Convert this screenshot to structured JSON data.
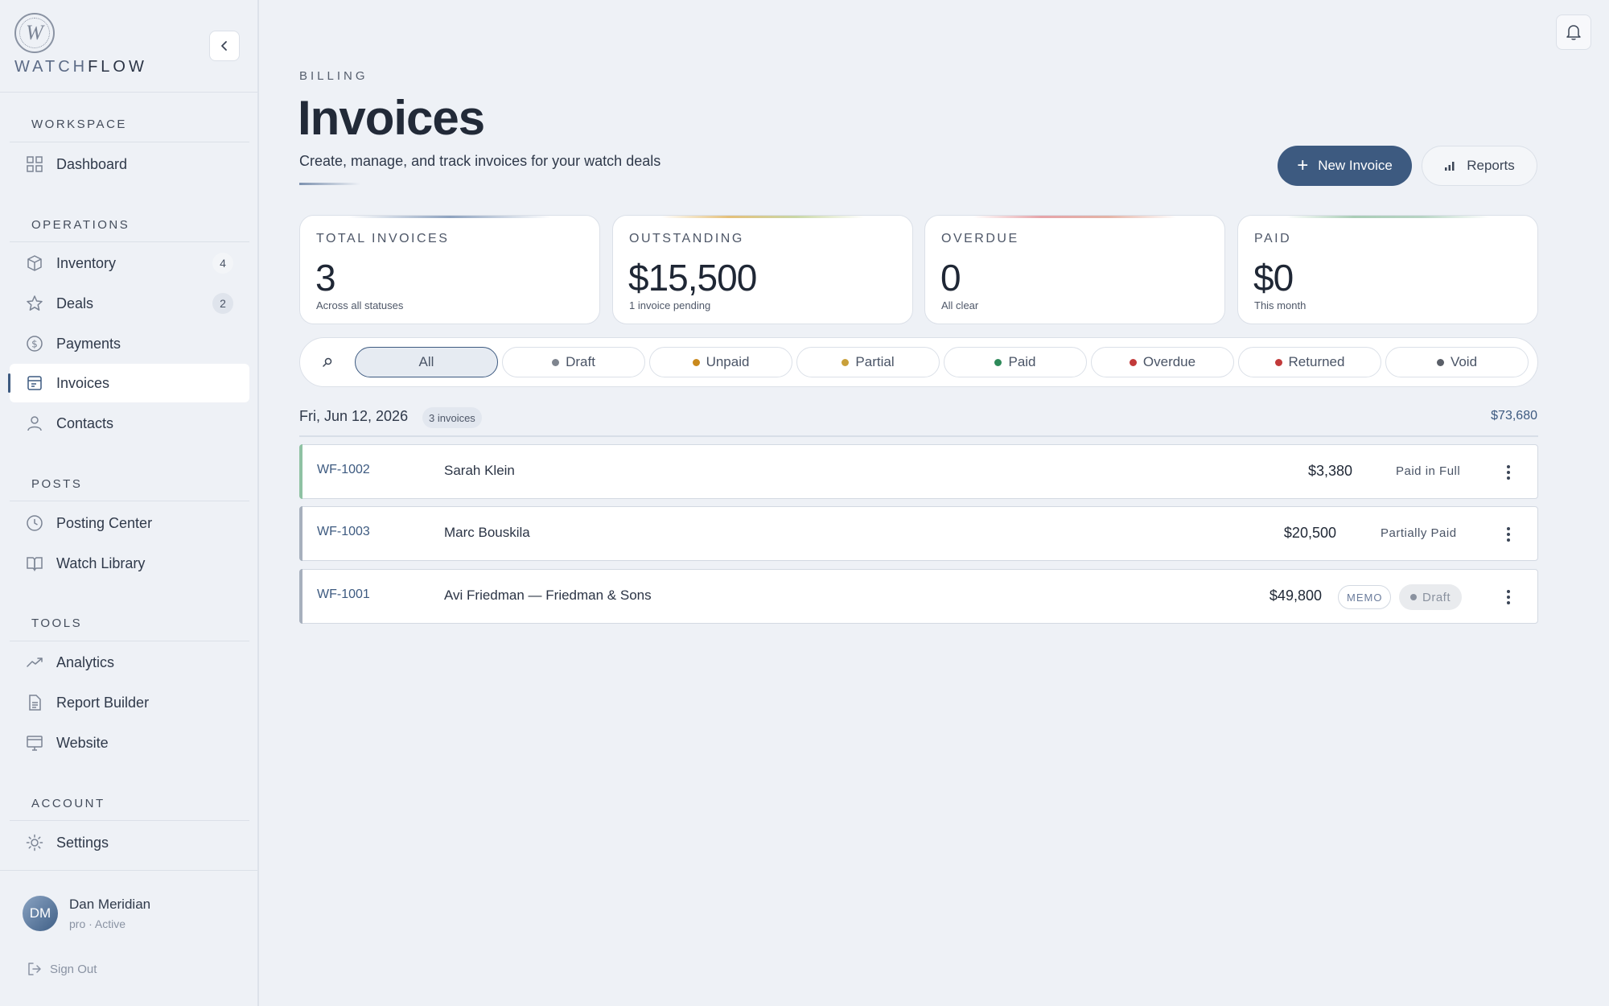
{
  "brand": {
    "logo_letter": "W",
    "name_part1": "WATCH",
    "name_part2": "FLOW"
  },
  "sidebar": {
    "sections": [
      {
        "label": "WORKSPACE"
      },
      {
        "label": "OPERATIONS"
      },
      {
        "label": "POSTS"
      },
      {
        "label": "TOOLS"
      },
      {
        "label": "ACCOUNT"
      }
    ],
    "items": [
      {
        "label": "Dashboard",
        "icon": "grid-icon"
      },
      {
        "label": "Inventory",
        "icon": "box-icon",
        "badge": "4"
      },
      {
        "label": "Deals",
        "icon": "star-icon",
        "badge": "2"
      },
      {
        "label": "Payments",
        "icon": "dollar-circle-icon"
      },
      {
        "label": "Invoices",
        "icon": "invoice-icon",
        "active": true
      },
      {
        "label": "Contacts",
        "icon": "person-icon"
      },
      {
        "label": "Posting Center",
        "icon": "clock-icon"
      },
      {
        "label": "Watch Library",
        "icon": "book-icon"
      },
      {
        "label": "Analytics",
        "icon": "trend-icon"
      },
      {
        "label": "Report Builder",
        "icon": "document-icon"
      },
      {
        "label": "Website",
        "icon": "monitor-icon"
      },
      {
        "label": "Settings",
        "icon": "gear-icon"
      }
    ],
    "user": {
      "initials": "DM",
      "name": "Dan Meridian",
      "status": "pro · Active"
    },
    "sign_out": "Sign Out"
  },
  "header": {
    "eyebrow": "BILLING",
    "title": "Invoices",
    "subtitle": "Create, manage, and track invoices for your watch deals",
    "new_invoice": "New Invoice",
    "reports": "Reports"
  },
  "stats": [
    {
      "label": "TOTAL INVOICES",
      "value": "3",
      "sub": "Across all statuses"
    },
    {
      "label": "OUTSTANDING",
      "value": "$15,500",
      "sub": "1 invoice pending"
    },
    {
      "label": "OVERDUE",
      "value": "0",
      "sub": "All clear"
    },
    {
      "label": "PAID",
      "value": "$0",
      "sub": "This month"
    }
  ],
  "filters": [
    {
      "label": "All",
      "active": true
    },
    {
      "label": "Draft",
      "color": "#7f858f"
    },
    {
      "label": "Unpaid",
      "color": "#c9891d"
    },
    {
      "label": "Partial",
      "color": "#c9a03a"
    },
    {
      "label": "Paid",
      "color": "#2e8a5a"
    },
    {
      "label": "Overdue",
      "color": "#c23a3a"
    },
    {
      "label": "Returned",
      "color": "#c23a3a"
    },
    {
      "label": "Void",
      "color": "#5a5f68"
    }
  ],
  "group": {
    "date": "Fri, Jun 12, 2026",
    "count": "3 invoices",
    "total": "$73,680"
  },
  "invoices": [
    {
      "id": "WF-1002",
      "client": "Sarah Klein",
      "amount": "$3,380",
      "status": "Paid in Full",
      "edge_color": "#8fc2a3"
    },
    {
      "id": "WF-1003",
      "client": "Marc Bouskila",
      "amount": "$20,500",
      "status": "Partially Paid",
      "edge_color": "#a7b0bd"
    },
    {
      "id": "WF-1001",
      "client": "Avi Friedman — Friedman & Sons",
      "amount": "$49,800",
      "memo": "MEMO",
      "status": "Draft",
      "edge_color": "#a7b0bd"
    }
  ]
}
